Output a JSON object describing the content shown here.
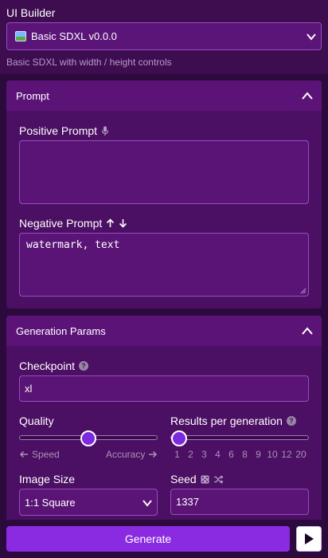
{
  "header": {
    "title": "UI Builder",
    "workflow_selected": "Basic SDXL v0.0.0",
    "workflow_description": "Basic SDXL with width / height controls"
  },
  "prompt_panel": {
    "title": "Prompt",
    "positive_label": "Positive Prompt",
    "positive_value": "",
    "negative_label": "Negative Prompt",
    "negative_value": "watermark, text"
  },
  "params_panel": {
    "title": "Generation Params",
    "checkpoint_label": "Checkpoint",
    "checkpoint_value": "xl",
    "quality_label": "Quality",
    "quality_level": 0.5,
    "quality_left_hint": "Speed",
    "quality_right_hint": "Accuracy",
    "results_label": "Results per generation",
    "results_ticks": [
      "1",
      "2",
      "3",
      "4",
      "6",
      "8",
      "9",
      "10",
      "12",
      "20"
    ],
    "results_selected": "1",
    "image_size_label": "Image Size",
    "image_size_value": "1:1 Square",
    "seed_label": "Seed",
    "seed_value": "1337"
  },
  "footer": {
    "generate_label": "Generate"
  },
  "colors": {
    "background": "#2d0a3e",
    "panel": "#4b0f63",
    "panel_header": "#5c1378",
    "accent": "#8a2be2",
    "field_border": "#9b4dc0"
  }
}
